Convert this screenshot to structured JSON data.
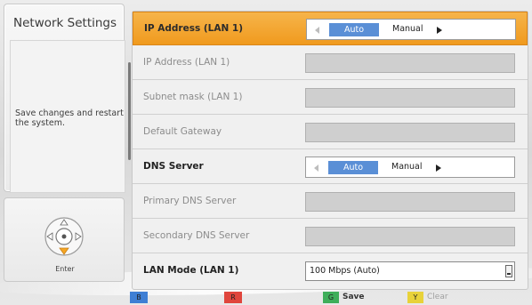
{
  "page_title": "Network Settings",
  "help_text": "Save changes and restart the system.",
  "nav": {
    "enter_label": "Enter"
  },
  "colors": {
    "selected_row": "#f2a530",
    "auto_highlight": "#5a8fd6",
    "blue_button": "#3f7fd4",
    "red_button": "#e0453c",
    "green_button": "#3fae5a",
    "yellow_button": "#e8d23a"
  },
  "rows": [
    {
      "label": "IP Address (LAN 1)",
      "state": "selected",
      "control": "selector",
      "option_selected": "Auto",
      "option_other": "Manual"
    },
    {
      "label": "IP Address (LAN 1)",
      "state": "disabled",
      "control": "field",
      "value": ""
    },
    {
      "label": "Subnet mask (LAN 1)",
      "state": "disabled",
      "control": "field",
      "value": ""
    },
    {
      "label": "Default Gateway",
      "state": "disabled",
      "control": "field",
      "value": ""
    },
    {
      "label": "DNS Server",
      "state": "active",
      "control": "selector",
      "option_selected": "Auto",
      "option_other": "Manual"
    },
    {
      "label": "Primary DNS Server",
      "state": "disabled",
      "control": "field",
      "value": ""
    },
    {
      "label": "Secondary DNS Server",
      "state": "disabled",
      "control": "field",
      "value": ""
    },
    {
      "label": "LAN Mode (LAN 1)",
      "state": "active",
      "control": "dropdown",
      "value": "100 Mbps (Auto)"
    }
  ],
  "color_buttons": [
    {
      "key": "B",
      "label": ""
    },
    {
      "key": "R",
      "label": ""
    },
    {
      "key": "G",
      "label": "Save"
    },
    {
      "key": "Y",
      "label": "Clear"
    }
  ]
}
